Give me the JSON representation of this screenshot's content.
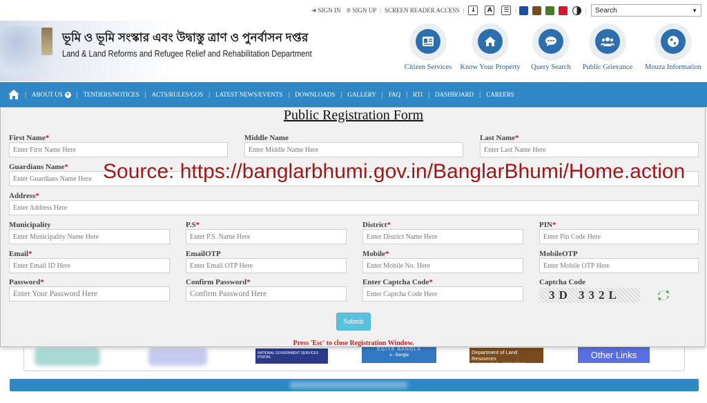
{
  "topbar": {
    "sign_in": "SIGN IN",
    "sign_up": "SIGN UP",
    "screen_reader": "SCREEN READER ACCESS",
    "search_value": "Search",
    "theme_colors": [
      "#1f4e9c",
      "#7a4a1f",
      "#4a7a2a",
      "#d01830"
    ]
  },
  "header": {
    "dept_bn": "ভূমি ও ভূমি সংস্কার এবং উদ্বাস্তু ত্রাণ ও পুনর্বাসন দপ্তর",
    "dept_en": "Land & Land Reforms and Refugee Relief and Rehabilitation Department",
    "services": [
      {
        "label": "Citizen Services",
        "icon": "id-card-icon"
      },
      {
        "label": "Know Your Property",
        "icon": "home-icon"
      },
      {
        "label": "Query Search",
        "icon": "chat-icon"
      },
      {
        "label": "Public Grievance",
        "icon": "users-icon"
      },
      {
        "label": "Mouza Information",
        "icon": "globe-icon"
      }
    ]
  },
  "nav": {
    "items": [
      "ABOUT US",
      "TENDERS/NOTICES",
      "ACTS/RULES/GOS",
      "LATEST NEWS/EVENTS",
      "DOWNLOADS",
      "GALLERY",
      "FAQ",
      "RTI",
      "DASHBOARD",
      "CAREERS"
    ]
  },
  "background": {
    "ngsp_text": "NATIONAL GOVERNMENT SERVICES PORTAL",
    "egiye_text": "EGIYE BANGLA",
    "egiye_sub": "e - Bangla",
    "dolr_title": "Department of Land Resources",
    "dolr_sub": "Government of India - Ministry of Rural Development",
    "other_links": "Other Links"
  },
  "form": {
    "title": "Public Registration Form",
    "watermark": "Source: https://banglarbhumi.gov.in/BanglarBhumi/Home.action",
    "fields": {
      "first_name": {
        "label": "First Name",
        "placeholder": "Enter First Name Here"
      },
      "middle_name": {
        "label": "Middle Name",
        "placeholder": "Enter Middle Name Here"
      },
      "last_name": {
        "label": "Last Name",
        "placeholder": "Enter Last Name Here"
      },
      "guardian_name": {
        "label": "Guardians Name",
        "placeholder": "Enter Guardians Name Here"
      },
      "address": {
        "label": "Address",
        "placeholder": "Enter Address Here"
      },
      "municipality": {
        "label": "Municipality",
        "placeholder": "Enter Municipality Name Here"
      },
      "ps": {
        "label": "P.S",
        "placeholder": "Enter P.S. Name Here"
      },
      "district": {
        "label": "District",
        "placeholder": "Enter District Name Here"
      },
      "pin": {
        "label": "PIN",
        "placeholder": "Enter Pin Code Here"
      },
      "email": {
        "label": "Email",
        "placeholder": "Enter Email ID Here"
      },
      "email_otp": {
        "label": "EmailOTP",
        "placeholder": "Enter Email OTP Here"
      },
      "mobile": {
        "label": "Mobile",
        "placeholder": "Enter Mobile No. Here"
      },
      "mobile_otp": {
        "label": "MobileOTP",
        "placeholder": "Enter Mobile OTP Here"
      },
      "password": {
        "label": "Password",
        "placeholder": "Enter Your Password Here"
      },
      "confirm_password": {
        "label": "Confirm Password",
        "placeholder": "Confirm Password Here"
      },
      "captcha_input": {
        "label": "Enter Captcha Code",
        "placeholder": "Enter Captcha Code Here"
      },
      "captcha": {
        "label": "Captcha Code",
        "value": "3D 332L"
      }
    },
    "submit_label": "Submit",
    "esc_note": "Press 'Esc' to close Registration Window."
  }
}
